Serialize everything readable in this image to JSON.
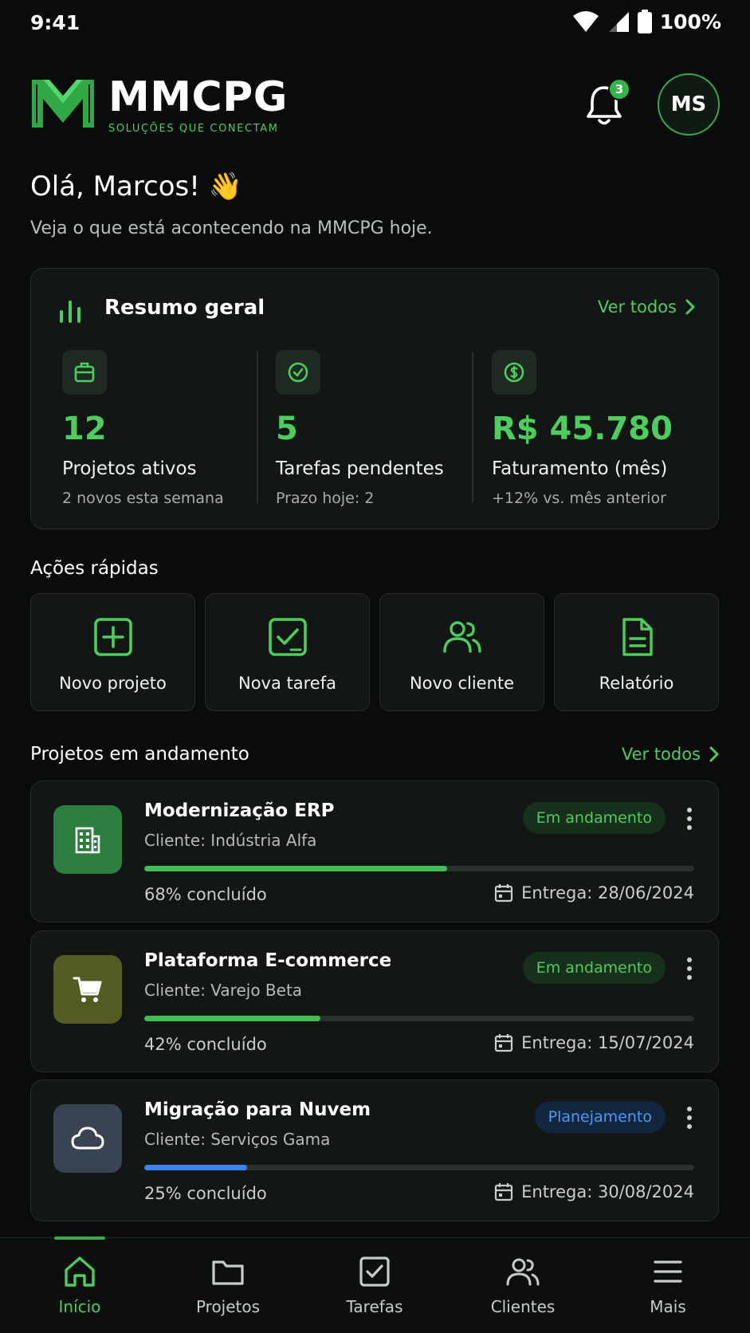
{
  "status": {
    "time": "9:41",
    "battery": "100%"
  },
  "header": {
    "brand": "MMCPG",
    "tagline": "SOLUÇÕES QUE CONECTAM",
    "notifications": "3",
    "avatar_initials": "MS"
  },
  "greeting": {
    "title": "Olá, Marcos! 👋",
    "subtitle": "Veja o que está acontecendo na MMCPG hoje."
  },
  "summary": {
    "title": "Resumo geral",
    "see_all": "Ver todos",
    "stats": [
      {
        "icon": "briefcase-icon",
        "value": "12",
        "label": "Projetos ativos",
        "sub": "2 novos esta semana"
      },
      {
        "icon": "check-circle-icon",
        "value": "5",
        "label": "Tarefas pendentes",
        "sub": "Prazo hoje: 2"
      },
      {
        "icon": "dollar-icon",
        "value": "R$ 45.780",
        "label": "Faturamento (mês)",
        "sub": "+12% vs. mês anterior"
      }
    ]
  },
  "quick_actions": {
    "title": "Ações rápidas",
    "items": [
      {
        "icon": "plus-square-icon",
        "label": "Novo projeto"
      },
      {
        "icon": "task-check-icon",
        "label": "Nova tarefa"
      },
      {
        "icon": "users-icon",
        "label": "Novo cliente"
      },
      {
        "icon": "document-icon",
        "label": "Relatório"
      }
    ]
  },
  "projects": {
    "title": "Projetos em andamento",
    "see_all": "Ver todos",
    "items": [
      {
        "icon": "building-icon",
        "name": "Modernização ERP",
        "client": "Cliente: Indústria Alfa",
        "status": "Em andamento",
        "progress": 0.55,
        "progress_text": "68% concluído",
        "due": "Entrega: 28/06/2024"
      },
      {
        "icon": "cart-icon",
        "name": "Plataforma E-commerce",
        "client": "Cliente: Varejo Beta",
        "status": "Em andamento",
        "progress": 0.32,
        "progress_text": "42% concluído",
        "due": "Entrega: 15/07/2024"
      },
      {
        "icon": "cloud-icon",
        "name": "Migração para Nuvem",
        "client": "Cliente: Serviços Gama",
        "status": "Planejamento",
        "progress": 0.187,
        "progress_text": "25% concluído",
        "due": "Entrega: 30/08/2024"
      }
    ]
  },
  "nav": {
    "items": [
      {
        "icon": "home-icon",
        "label": "Início",
        "active": true
      },
      {
        "icon": "folder-icon",
        "label": "Projetos",
        "active": false
      },
      {
        "icon": "task-check-icon",
        "label": "Tarefas",
        "active": false
      },
      {
        "icon": "users-icon",
        "label": "Clientes",
        "active": false
      },
      {
        "icon": "menu-icon",
        "label": "Mais",
        "active": false
      }
    ]
  },
  "colors": {
    "accent": "#4ccd5e",
    "background": "#0a0c0b",
    "card": "#121614",
    "status_active_bg": "#16301c",
    "status_planning_bg": "#132640",
    "status_planning_fg": "#4b9bf5",
    "progress_blue": "#3a82e8"
  }
}
